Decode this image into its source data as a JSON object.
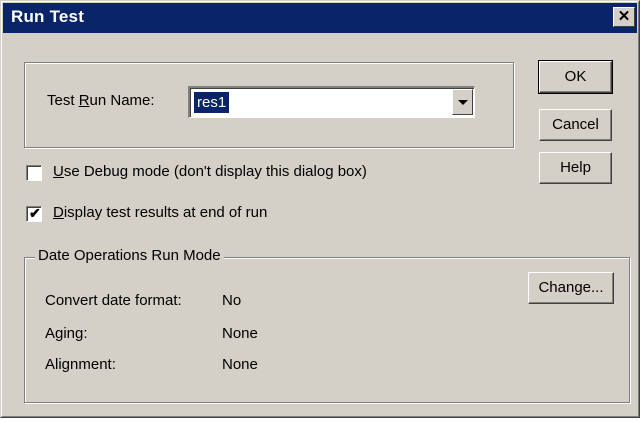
{
  "window": {
    "title": "Run Test",
    "close_glyph": "✕"
  },
  "test_run": {
    "label_prefix": "Test ",
    "label_mnemonic": "R",
    "label_suffix": "un Name:",
    "value": "res1"
  },
  "buttons": {
    "ok": "OK",
    "cancel": "Cancel",
    "help": "Help",
    "change_prefix": "Chan",
    "change_mnemonic": "g",
    "change_suffix": "e..."
  },
  "options": {
    "debug": {
      "mnemonic": "U",
      "rest": "se Debug mode (don't display this dialog box)",
      "checked": false
    },
    "display_results": {
      "mnemonic": "D",
      "rest": "isplay test results at end of run",
      "checked": true,
      "check_glyph": "✔"
    }
  },
  "date_ops": {
    "title": "Date Operations Run Mode",
    "rows": [
      {
        "label": "Convert date format:",
        "value": "No"
      },
      {
        "label": "Aging:",
        "value": "None"
      },
      {
        "label": "Alignment:",
        "value": "None"
      }
    ]
  }
}
